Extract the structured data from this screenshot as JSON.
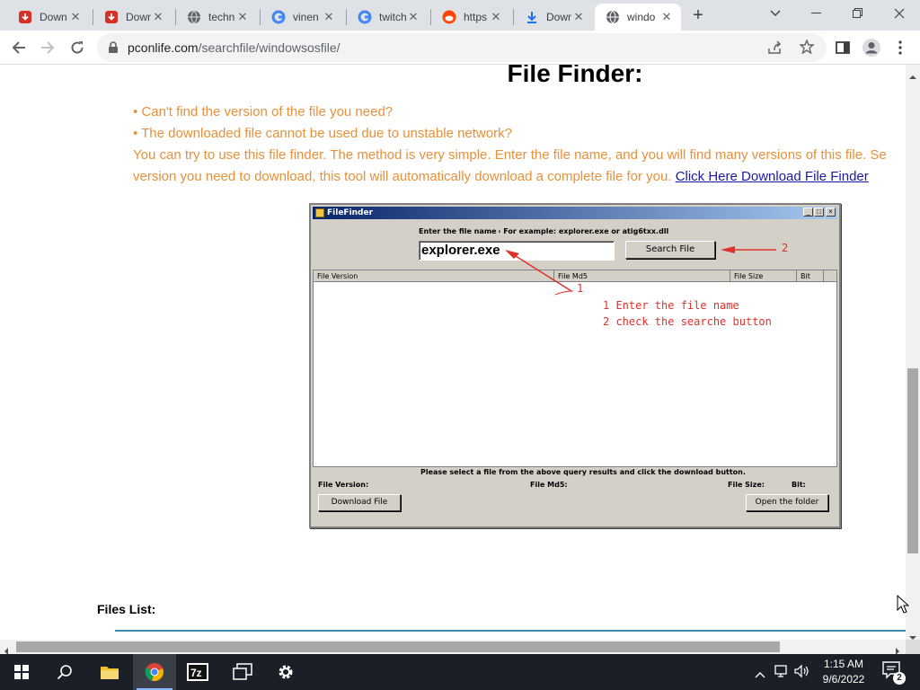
{
  "tabs": [
    {
      "title": "Down",
      "icon": "download-red-icon"
    },
    {
      "title": "Down",
      "icon": "download-red-icon"
    },
    {
      "title": "techn",
      "icon": "globe-icon"
    },
    {
      "title": "vinen",
      "icon": "google-icon"
    },
    {
      "title": "twitch",
      "icon": "google-icon"
    },
    {
      "title": "https",
      "icon": "reddit-icon"
    },
    {
      "title": "Down",
      "icon": "download-blue-icon"
    },
    {
      "title": "windo",
      "icon": "globe-icon"
    }
  ],
  "address_bar": {
    "domain": "pconlife.com",
    "path": "/searchfile/windowsosfile/"
  },
  "page": {
    "heading": "File Finder:",
    "bullet1": "• Can't find the version of the file you need?",
    "bullet2": "• The downloaded file cannot be used due to unstable network?",
    "paragraph_line1": "You can try to use this file finder. The method is very simple. Enter the file name, and you will find many versions of this file. Se",
    "paragraph_line2": "version you need to download, this tool will automatically download a complete file for you.",
    "link": "Click Here Download File Finder",
    "files_list_label": "Files List:"
  },
  "filefinder": {
    "title": "FileFinder",
    "prompt": "Enter the file name ›  For example: explorer.exe or atig6txx.dll",
    "input_value": "explorer.exe",
    "search_button": "Search File",
    "columns": [
      "File Version",
      "File Md5",
      "File Size",
      "Bit"
    ],
    "instruction": "Please select a file from the above query results and click the download button.",
    "field_version": "File Version:",
    "field_md5": "File Md5:",
    "field_size": "File Size:",
    "field_bit": "Bit:",
    "download_button": "Download File",
    "open_folder_button": "Open the folder",
    "annotation_1": "1",
    "annotation_2": "2",
    "note_line1": "1 Enter the file name",
    "note_line2": "2 check the searche button",
    "annotation_color": "#e0302a"
  },
  "taskbar": {
    "time": "1:15 AM",
    "date": "9/6/2022",
    "notification_count": "2",
    "apps": [
      "start-icon",
      "search-icon",
      "file-explorer-icon",
      "chrome-icon",
      "7zip-icon",
      "task-view-icon",
      "settings-icon"
    ]
  }
}
